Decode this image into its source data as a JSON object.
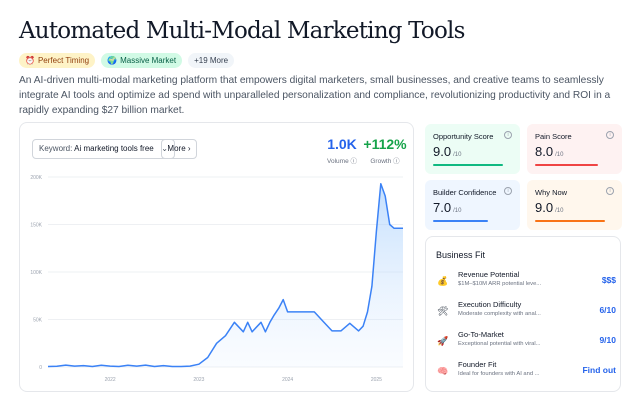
{
  "page": {
    "title": "Automated Multi-Modal Marketing Tools",
    "tags": [
      {
        "icon": "alarm-clock-icon",
        "glyph": "⏰",
        "label": "Perfect Timing"
      },
      {
        "icon": "globe-icon",
        "glyph": "🌍",
        "label": "Massive Market"
      },
      {
        "icon": "",
        "glyph": "",
        "label": "+19 More"
      }
    ],
    "description": "An AI-driven multi-modal marketing platform that empowers digital marketers, small businesses, and creative teams to seamlessly integrate AI tools and optimize ad spend with unparalleled personalization and compliance, revolutionizing productivity and ROI in a rapidly expanding $27 billion market."
  },
  "trend": {
    "keyword_label": "Keyword:",
    "keyword_value": "Ai marketing tools free",
    "more_label": "More",
    "volume_value": "1.0K",
    "volume_label": "Volume",
    "growth_value": "+112%",
    "growth_label": "Growth",
    "colors": {
      "volume": "#2563eb",
      "growth": "#16a34a",
      "line": "#3b82f6"
    }
  },
  "chart_data": {
    "type": "area",
    "y_ticks": [
      "0",
      "50K",
      "100K",
      "150K",
      "200K"
    ],
    "x_ticks": [
      "2022",
      "2023",
      "2024",
      "2025"
    ],
    "ylim": [
      0,
      200000
    ],
    "xlim": [
      2021.3,
      2025.3
    ],
    "x": [
      2021.3,
      2021.4,
      2021.5,
      2021.6,
      2021.7,
      2021.8,
      2021.9,
      2022.0,
      2022.1,
      2022.2,
      2022.3,
      2022.4,
      2022.5,
      2022.6,
      2022.7,
      2022.8,
      2022.9,
      2023.0,
      2023.1,
      2023.2,
      2023.3,
      2023.4,
      2023.5,
      2023.55,
      2023.6,
      2023.7,
      2023.75,
      2023.8,
      2023.85,
      2023.9,
      2023.95,
      2024.0,
      2024.1,
      2024.2,
      2024.3,
      2024.4,
      2024.5,
      2024.6,
      2024.7,
      2024.8,
      2024.85,
      2024.9,
      2024.95,
      2025.0,
      2025.05,
      2025.1,
      2025.15,
      2025.2,
      2025.25,
      2025.3
    ],
    "series": [
      {
        "values": [
          500,
          800,
          2000,
          1000,
          1500,
          500,
          1800,
          1000,
          500,
          1800,
          1000,
          2000,
          500,
          1500,
          500,
          500,
          1000,
          3000,
          10000,
          25000,
          33000,
          47000,
          37000,
          47000,
          37000,
          47000,
          37000,
          47000,
          55000,
          62000,
          71000,
          58000,
          58000,
          58000,
          58000,
          48000,
          38000,
          38000,
          46000,
          38000,
          43000,
          58000,
          85000,
          143000,
          193000,
          180000,
          150000,
          146000,
          146000,
          146000
        ]
      }
    ]
  },
  "scores": [
    {
      "label": "Opportunity Score",
      "value": "9.0",
      "max": "/10"
    },
    {
      "label": "Pain Score",
      "value": "8.0",
      "max": "/10"
    },
    {
      "label": "Builder Confidence",
      "value": "7.0",
      "max": "/10"
    },
    {
      "label": "Why Now",
      "value": "9.0",
      "max": "/10"
    }
  ],
  "score_colors": [
    "#10b981",
    "#ef4444",
    "#3b82f6",
    "#f97316"
  ],
  "business_fit": {
    "title": "Business Fit",
    "rows": [
      {
        "icon": "money-bag-icon",
        "glyph": "💰",
        "name": "Revenue Potential",
        "sub": "$1M–$10M ARR potential leve...",
        "value": "$$$"
      },
      {
        "icon": "tools-icon",
        "glyph": "🛠",
        "name": "Execution Difficulty",
        "sub": "Moderate complexity with anal...",
        "value": "6/10"
      },
      {
        "icon": "rocket-icon",
        "glyph": "🚀",
        "name": "Go-To-Market",
        "sub": "Exceptional potential with viral...",
        "value": "9/10"
      },
      {
        "icon": "brain-icon",
        "glyph": "🧠",
        "name": "Founder Fit",
        "sub": "Ideal for founders with AI and ...",
        "value": "Find out"
      }
    ]
  }
}
